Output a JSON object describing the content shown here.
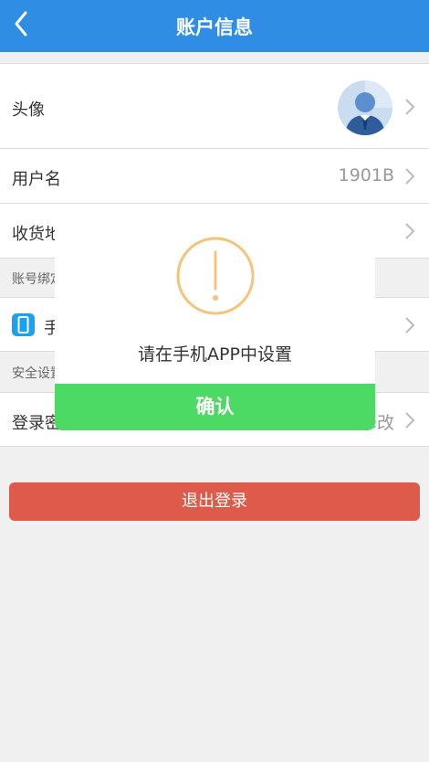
{
  "header": {
    "title": "账户信息",
    "back_icon": "chevron-left-icon"
  },
  "profile": {
    "avatar_label": "头像",
    "username_label": "用户名",
    "username_value": "1901B",
    "address_label": "收货地址"
  },
  "sections": {
    "binding_label": "账号绑定",
    "phone_label": "手机",
    "security_label": "安全设置",
    "password_label": "登录密码",
    "password_action": "修改"
  },
  "logout_label": "退出登录",
  "dialog": {
    "message": "请在手机APP中设置",
    "confirm_label": "确认",
    "icon": "warning-icon"
  },
  "colors": {
    "header": "#2f8de4",
    "logout": "#de5a4a",
    "confirm": "#4cd964",
    "warning": "#f3c57a"
  }
}
